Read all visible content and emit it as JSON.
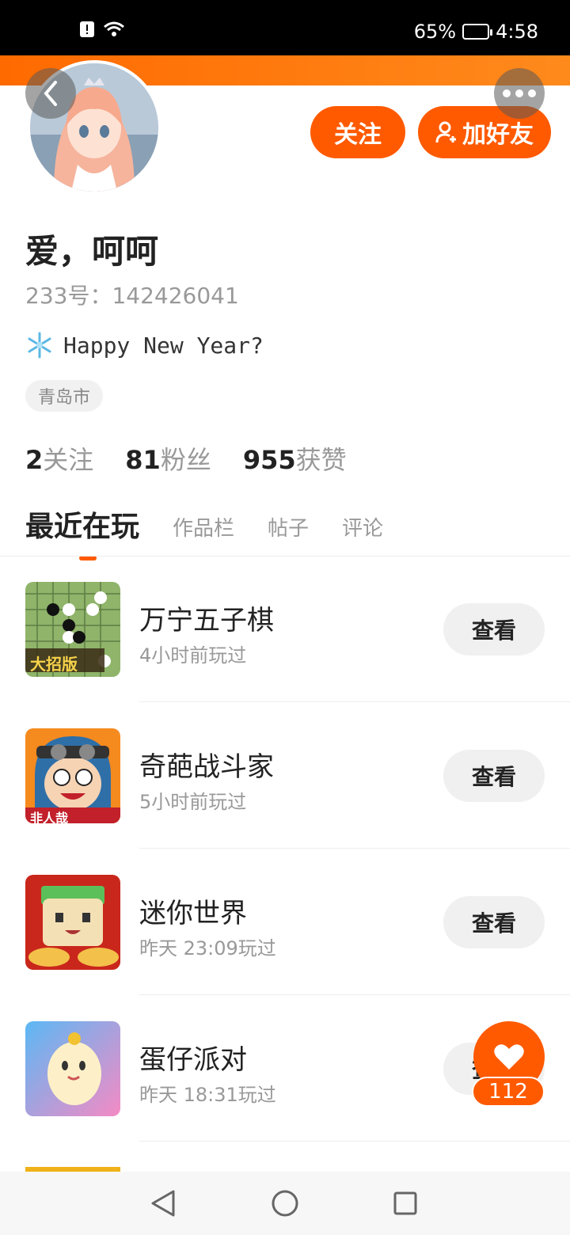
{
  "status_bar": {
    "battery": "65%",
    "time": "4:58"
  },
  "profile": {
    "name": "爱，呵呵",
    "uid_label": "233号：",
    "uid": "142426041",
    "bio": "Happy New Year?",
    "location": "青岛市",
    "follow_button": "关注",
    "add_friend_button": "加好友"
  },
  "stats": [
    {
      "value": "2",
      "label": "关注"
    },
    {
      "value": "81",
      "label": "粉丝"
    },
    {
      "value": "955",
      "label": "获赞"
    }
  ],
  "tabs": [
    "最近在玩",
    "作品栏",
    "帖子",
    "评论"
  ],
  "games": [
    {
      "title": "万宁五子棋",
      "time": "4小时前玩过",
      "button": "查看"
    },
    {
      "title": "奇葩战斗家",
      "time": "5小时前玩过",
      "button": "查看"
    },
    {
      "title": "迷你世界",
      "time": "昨天 23:09玩过",
      "button": "查看"
    },
    {
      "title": "蛋仔派对",
      "time": "昨天 18:31玩过",
      "button": "查看"
    }
  ],
  "game_icon_text": {
    "gomoku": "大招版",
    "qipa": "非人哉"
  },
  "like_badge": "112",
  "colors": {
    "accent": "#ff5a00",
    "header": "#ff7a10"
  }
}
